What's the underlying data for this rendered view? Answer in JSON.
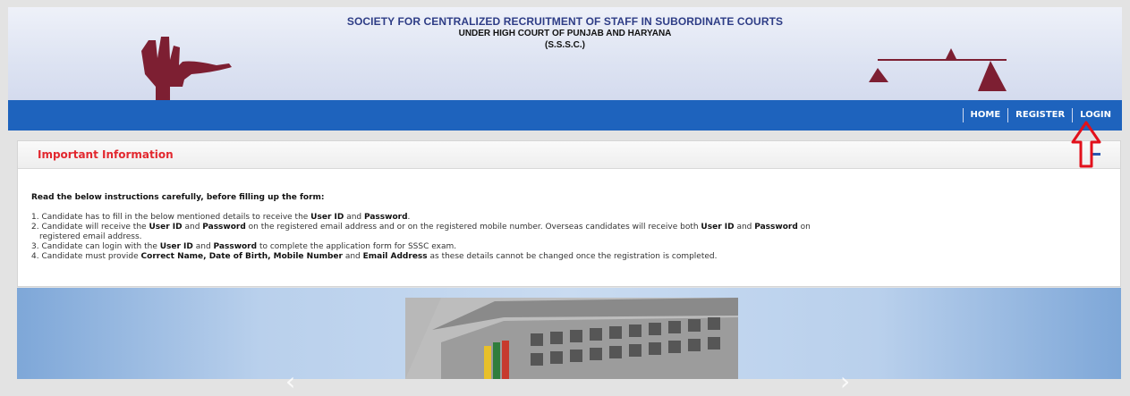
{
  "header": {
    "title_line1": "SOCIETY FOR CENTRALIZED RECRUITMENT OF STAFF IN SUBORDINATE COURTS",
    "title_line2": "UNDER HIGH COURT OF PUNJAB AND HARYANA",
    "title_line3": "(S.S.S.C.)",
    "logo_left": "open-hand-icon",
    "logo_right": "scales-icon"
  },
  "nav": {
    "items": [
      "HOME",
      "REGISTER",
      "LOGIN"
    ]
  },
  "info": {
    "heading": "Important Information",
    "intro": "Read the below instructions carefully, before filling up the form:",
    "s1_a": "1. Candidate has to fill in the below mentioned details to receive the ",
    "s1_b": "User ID",
    "s1_c": " and ",
    "s1_d": "Password",
    "s1_e": ".",
    "s2_a": "2. Candidate will receive the ",
    "s2_b": "User ID",
    "s2_c": " and ",
    "s2_d": "Password",
    "s2_e": " on the registered email address and or on the registered mobile number. Overseas candidates will receive both ",
    "s2_f": "User ID",
    "s2_g": " and ",
    "s2_h": "Password",
    "s2_i": " on",
    "s2_j": "registered email address.",
    "s3_a": "3. Candidate can login with the ",
    "s3_b": "User ID",
    "s3_c": " and ",
    "s3_d": "Password",
    "s3_e": " to complete the application form for SSSC exam.",
    "s4_a": "4. Candidate must provide ",
    "s4_b": "Correct Name, Date of Birth, Mobile Number",
    "s4_c": " and ",
    "s4_d": "Email Address",
    "s4_e": " as these details cannot be changed once the registration is completed."
  },
  "banner": {
    "prev_icon": "chevron-left-icon",
    "next_icon": "chevron-right-icon"
  },
  "colors": {
    "nav_bg": "#1e63bd",
    "heading_red": "#e2282f",
    "title_blue": "#2e3d86",
    "logo_maroon": "#7d1f32"
  }
}
